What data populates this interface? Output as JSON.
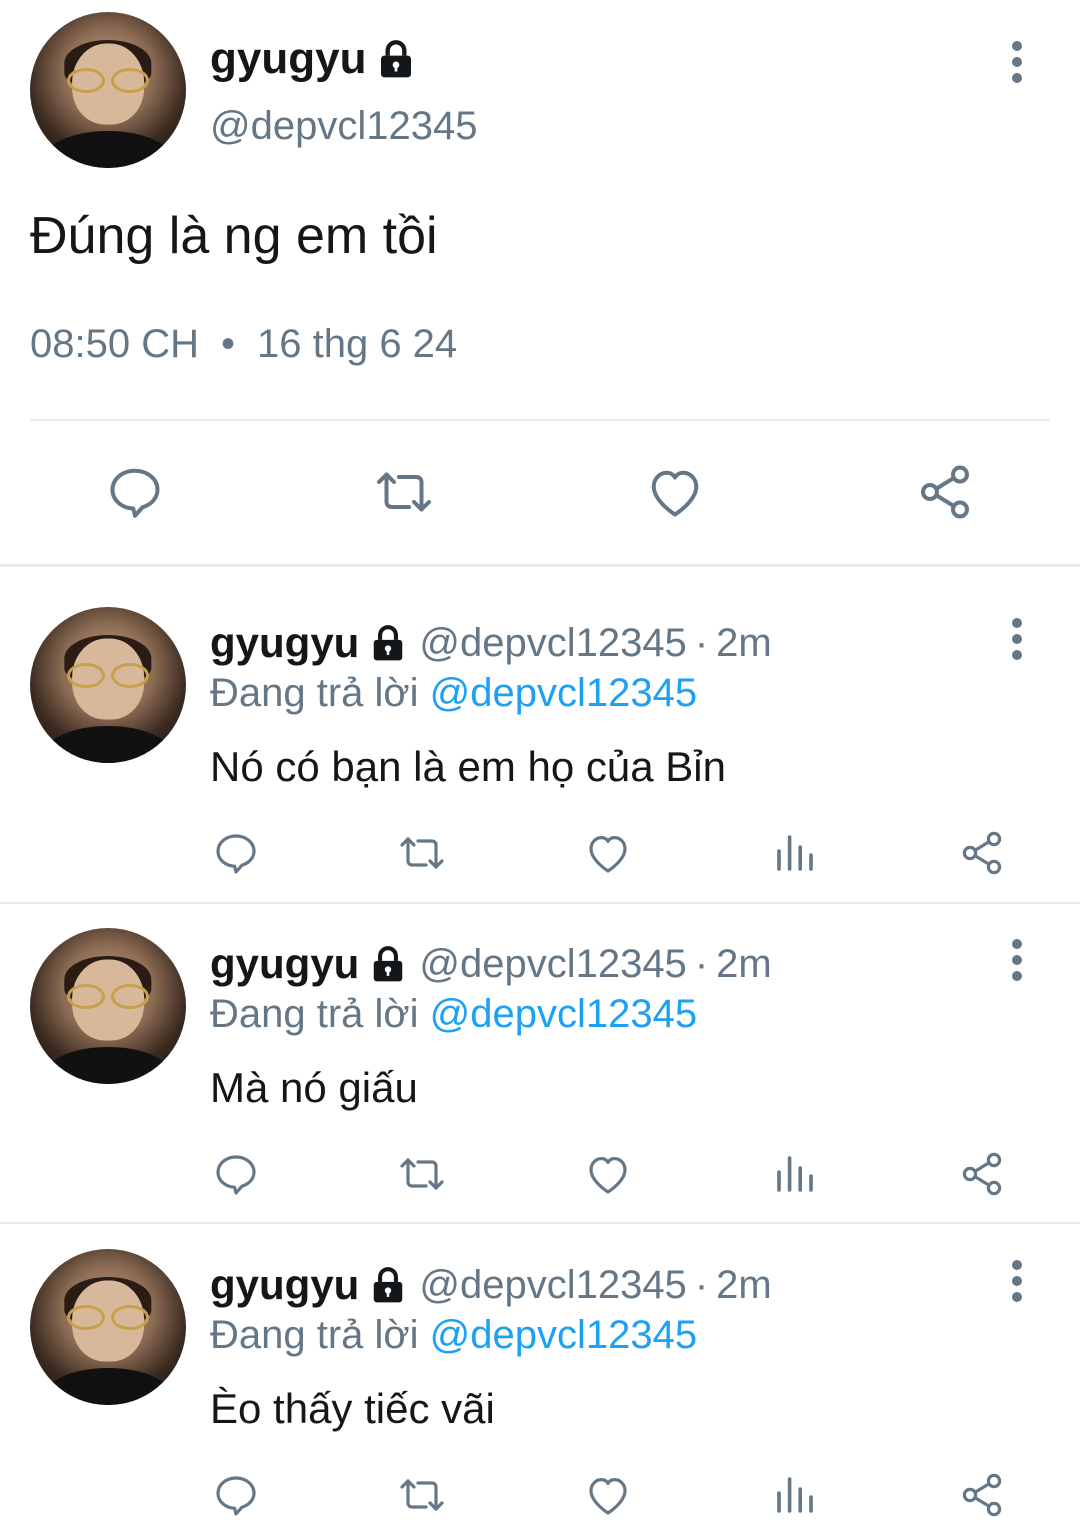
{
  "main_tweet": {
    "display_name": "gyugyu",
    "handle": "@depvcl12345",
    "text": "Đúng là ng em tồi",
    "time": "08:50 CH",
    "separator": "•",
    "date": "16 thg 6 24",
    "icons": [
      "reply-icon",
      "retweet-icon",
      "like-icon",
      "share-icon"
    ]
  },
  "replies": [
    {
      "display_name": "gyugyu",
      "handle": "@depvcl12345",
      "dot": "·",
      "time": "2m",
      "replying_prefix": "Đang trả lời",
      "replying_to": "@depvcl12345",
      "text": "Nó có bạn là em họ của Bỉn"
    },
    {
      "display_name": "gyugyu",
      "handle": "@depvcl12345",
      "dot": "·",
      "time": "2m",
      "replying_prefix": "Đang trả lời",
      "replying_to": "@depvcl12345",
      "text": "Mà nó giấu"
    },
    {
      "display_name": "gyugyu",
      "handle": "@depvcl12345",
      "dot": "·",
      "time": "2m",
      "replying_prefix": "Đang trả lời",
      "replying_to": "@depvcl12345",
      "text": "Èo thấy tiếc vãi"
    }
  ],
  "colors": {
    "text": "#14171a",
    "secondary": "#657786",
    "link": "#1da1f2",
    "divider": "#e6ecf0"
  }
}
